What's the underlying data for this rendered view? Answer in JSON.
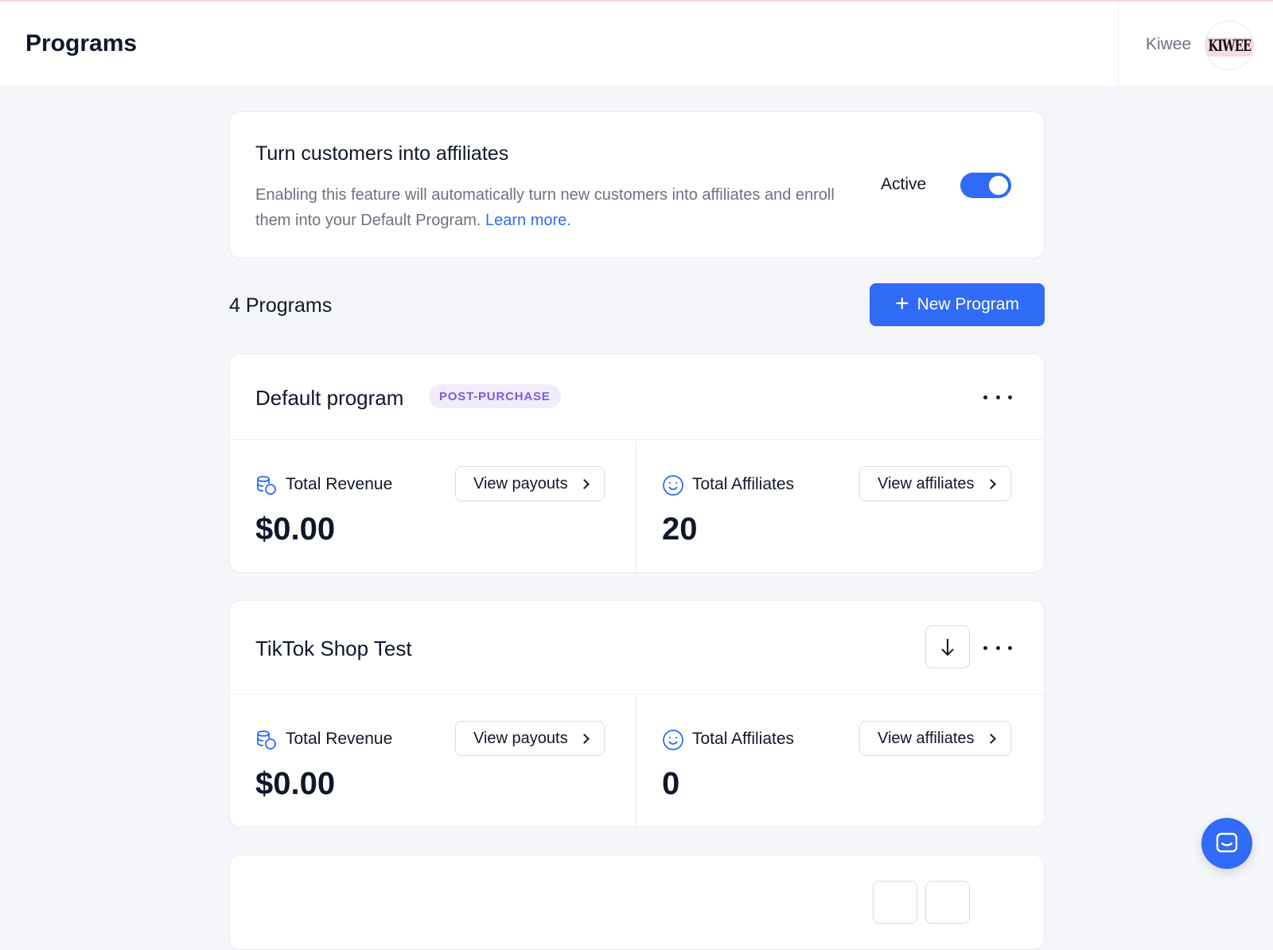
{
  "header": {
    "title": "Programs",
    "org_name": "Kiwee",
    "org_logo_text": "KIWEE"
  },
  "feature": {
    "title": "Turn customers into affiliates",
    "description": "Enabling this feature will automatically turn new customers into affiliates and enroll them into your Default Program.",
    "link_text": "Learn more.",
    "status_label": "Active",
    "enabled": true
  },
  "programs_header": {
    "count_label": "4 Programs",
    "new_button_label": "New Program"
  },
  "programs": [
    {
      "name": "Default program",
      "badge": "POST-PURCHASE",
      "revenue_label": "Total Revenue",
      "revenue_value": "$0.00",
      "payouts_button": "View payouts",
      "affiliates_label": "Total Affiliates",
      "affiliates_value": "20",
      "affiliates_button": "View affiliates"
    },
    {
      "name": "TikTok Shop Test",
      "badge": "",
      "revenue_label": "Total Revenue",
      "revenue_value": "$0.00",
      "payouts_button": "View payouts",
      "affiliates_label": "Total Affiliates",
      "affiliates_value": "0",
      "affiliates_button": "View affiliates"
    }
  ],
  "colors": {
    "accent": "#2f6bf6",
    "badge_bg": "#f1ecfb",
    "badge_text": "#7c5ce0",
    "page_bg": "#f5f6fa"
  },
  "icons": {
    "revenue": "coins-stack-icon",
    "affiliates": "smiley-face-icon",
    "more": "more-horizontal-icon",
    "download": "arrow-down-icon",
    "add": "plus-icon",
    "chat": "chat-bubble-icon",
    "chevron": "chevron-right-icon"
  }
}
